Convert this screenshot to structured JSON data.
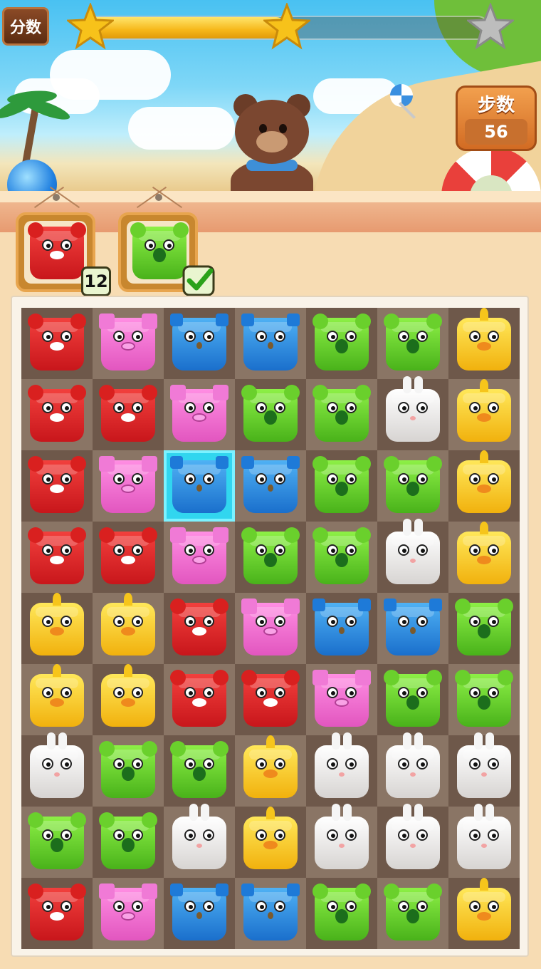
{
  "hud": {
    "score_label": "分数",
    "score_progress": 0.5,
    "stars_earned": 2,
    "stars_total": 3,
    "steps_label": "步数",
    "steps_value": "56"
  },
  "goals": [
    {
      "tile": "bear",
      "color": "#e8262a",
      "remaining": "12",
      "completed": false
    },
    {
      "tile": "frog",
      "color": "#5fce2b",
      "remaining": "",
      "completed": true
    }
  ],
  "board": {
    "columns": 7,
    "rows": 9,
    "selected": {
      "row": 3,
      "col": 3
    },
    "grid": [
      [
        "bear",
        "pig",
        "owl",
        "owl",
        "frog",
        "frog",
        "chick"
      ],
      [
        "bear",
        "bear",
        "pig",
        "frog",
        "frog",
        "bunny",
        "chick"
      ],
      [
        "bear",
        "pig",
        "owl",
        "owl",
        "frog",
        "frog",
        "chick"
      ],
      [
        "bear",
        "bear",
        "pig",
        "frog",
        "frog",
        "bunny",
        "chick"
      ],
      [
        "chick",
        "chick",
        "bear",
        "pig",
        "owl",
        "owl",
        "frog"
      ],
      [
        "chick",
        "chick",
        "bear",
        "bear",
        "pig",
        "frog",
        "frog"
      ],
      [
        "bunny",
        "frog",
        "frog",
        "chick",
        "bunny",
        "bunny",
        "bunny"
      ],
      [
        "frog",
        "frog",
        "bunny",
        "chick",
        "bunny",
        "bunny",
        "bunny"
      ],
      [
        "bear",
        "pig",
        "owl",
        "owl",
        "frog",
        "frog",
        "chick"
      ]
    ]
  },
  "colors": {
    "bear": "#e8262a",
    "pig": "#f16fd1",
    "owl": "#2f8fe2",
    "frog": "#5fce2b",
    "chick": "#f7c21f",
    "bunny": "#f0efee",
    "selected_cell": "#31d6ef"
  }
}
